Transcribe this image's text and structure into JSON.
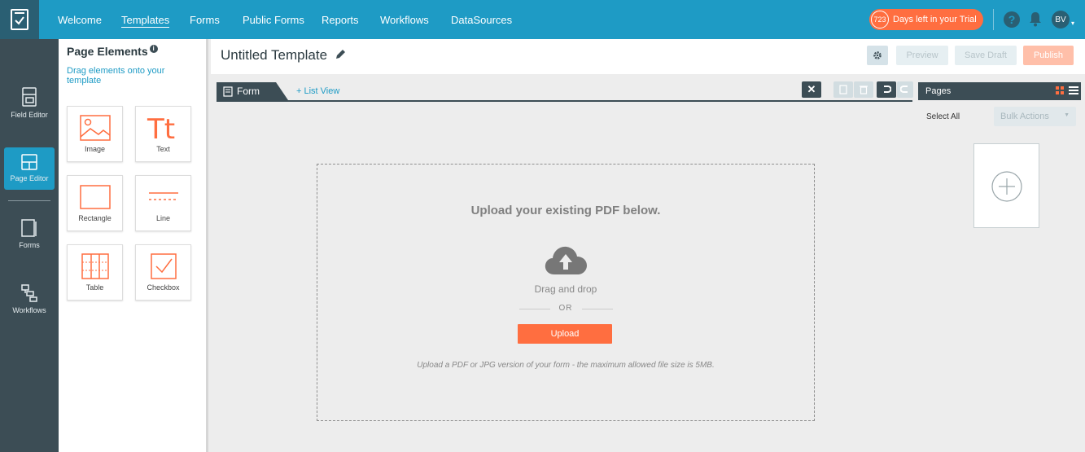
{
  "nav": {
    "items": [
      "Welcome",
      "Templates",
      "Forms",
      "Public Forms",
      "Reports",
      "Workflows",
      "DataSources"
    ],
    "active": "Templates",
    "trial_count": "723",
    "trial_text": "Days left in your Trial",
    "help_label": "?",
    "avatar_initials": "BV"
  },
  "rail": {
    "items": [
      {
        "label": "Field Editor",
        "icon": "field-editor-icon"
      },
      {
        "label": "Page Editor",
        "icon": "page-editor-icon",
        "active": true
      },
      {
        "label": "Forms",
        "icon": "forms-icon"
      },
      {
        "label": "Workflows",
        "icon": "workflows-icon"
      }
    ]
  },
  "panel": {
    "title": "Page Elements",
    "subtitle": "Drag elements onto your template",
    "elements": [
      {
        "label": "Image",
        "icon": "image-icon"
      },
      {
        "label": "Text",
        "icon": "text-icon"
      },
      {
        "label": "Rectangle",
        "icon": "rectangle-icon"
      },
      {
        "label": "Line",
        "icon": "line-icon"
      },
      {
        "label": "Table",
        "icon": "table-icon"
      },
      {
        "label": "Checkbox",
        "icon": "checkbox-icon"
      }
    ]
  },
  "header": {
    "title": "Untitled Template",
    "preview": "Preview",
    "save_draft": "Save Draft",
    "publish": "Publish"
  },
  "tabs": {
    "form": "Form",
    "list_view": "+ List View"
  },
  "pages": {
    "title": "Pages",
    "select_all": "Select All",
    "bulk_actions": "Bulk Actions"
  },
  "upload": {
    "title": "Upload your existing PDF below.",
    "drag": "Drag and drop",
    "or": "OR",
    "button": "Upload",
    "note": "Upload a PDF or JPG version of your form - the maximum allowed file size is 5MB."
  },
  "colors": {
    "nav_bg": "#1e9bc5",
    "rail_bg": "#3c4d55",
    "accent_orange": "#ff6e40",
    "publish_disabled": "#ffbfa9"
  }
}
